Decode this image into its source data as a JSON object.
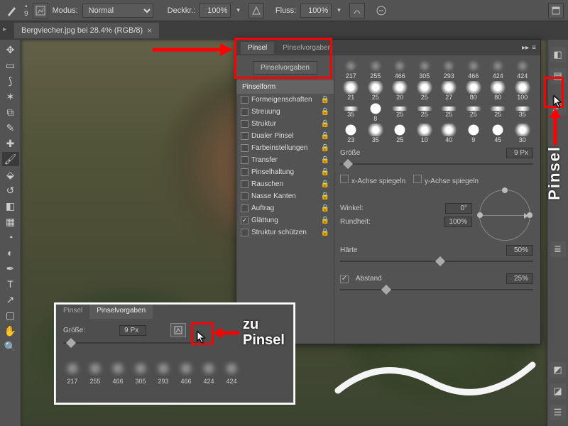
{
  "toolbar": {
    "brush_size": "9",
    "modus_label": "Modus:",
    "modus_value": "Normal",
    "opacity_label": "Deckkr.:",
    "opacity_value": "100%",
    "flow_label": "Fluss:",
    "flow_value": "100%"
  },
  "file_tab": {
    "title": "Bergviecher.jpg bei 28.4% (RGB/8)"
  },
  "brush_panel": {
    "tab_pinsel": "Pinsel",
    "tab_vorgaben": "Pinselvorgaben",
    "button": "Pinselvorgaben",
    "list_header": "Pinselform",
    "items": [
      {
        "label": "Formeigenschaften",
        "checked": false,
        "lock": true
      },
      {
        "label": "Streuung",
        "checked": false,
        "lock": true
      },
      {
        "label": "Struktur",
        "checked": false,
        "lock": true
      },
      {
        "label": "Dualer Pinsel",
        "checked": false,
        "lock": true
      },
      {
        "label": "Farbeinstellungen",
        "checked": false,
        "lock": true
      },
      {
        "label": "Transfer",
        "checked": false,
        "lock": true
      },
      {
        "label": "Pinselhaltung",
        "checked": false,
        "lock": true
      },
      {
        "label": "Rauschen",
        "checked": false,
        "lock": true
      },
      {
        "label": "Nasse Kanten",
        "checked": false,
        "lock": true
      },
      {
        "label": "Auftrag",
        "checked": false,
        "lock": true
      },
      {
        "label": "Glättung",
        "checked": true,
        "lock": true
      },
      {
        "label": "Struktur schützen",
        "checked": false,
        "lock": true
      }
    ],
    "thumbs": [
      "217",
      "255",
      "466",
      "305",
      "293",
      "466",
      "424",
      "424",
      "21",
      "25",
      "20",
      "25",
      "27",
      "80",
      "80",
      "100",
      "35",
      "8",
      "25",
      "25",
      "25",
      "25",
      "25",
      "35",
      "23",
      "35",
      "25",
      "10",
      "40",
      "9",
      "45",
      "30"
    ],
    "size_label": "Größe",
    "size_value": "9 Px",
    "flip_x": "x-Achse spiegeln",
    "flip_y": "y-Achse spiegeln",
    "angle_label": "Winkel:",
    "angle_value": "0°",
    "round_label": "Rundheit:",
    "round_value": "100%",
    "hard_label": "Härte",
    "hard_value": "50%",
    "spacing_label": "Abstand",
    "spacing_value": "25%"
  },
  "popup2": {
    "tab_pinsel": "Pinsel",
    "tab_vorgaben": "Pinselvorgaben",
    "size_label": "Größe:",
    "size_value": "9 Px",
    "thumbs": [
      "217",
      "255",
      "466",
      "305",
      "293",
      "466",
      "424",
      "424"
    ]
  },
  "callouts": {
    "zu_pinsel": "zu\nPinsel",
    "pinsel": "Pinsel"
  }
}
